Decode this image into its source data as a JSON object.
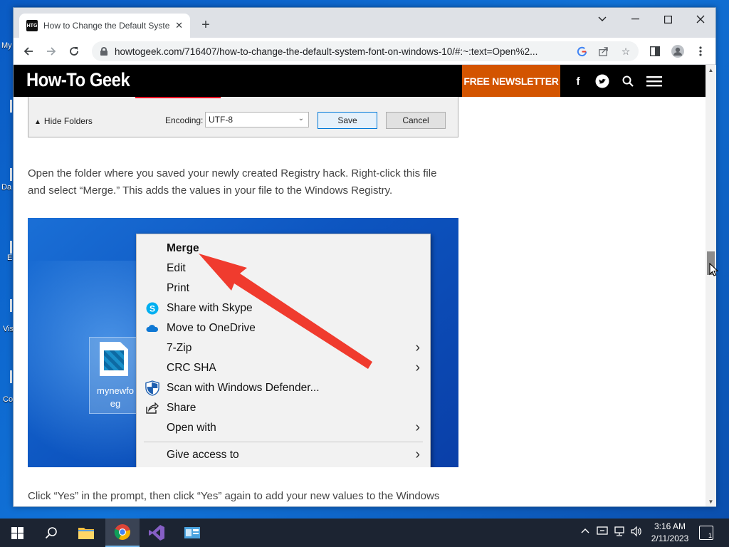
{
  "desktop": {
    "icon_labels": [
      "My",
      "Da",
      "E",
      "Vis",
      "Co"
    ]
  },
  "browser": {
    "tab_title": "How to Change the Default Syste",
    "favicon_text": "HTG",
    "url": "howtogeek.com/716407/how-to-change-the-default-system-font-on-windows-10/#:~:text=Open%2..."
  },
  "site": {
    "logo": "How-To Geek",
    "newsletter": "FREE NEWSLETTER"
  },
  "save_dialog": {
    "hide_folders": "Hide Folders",
    "encoding_label": "Encoding:",
    "encoding_value": "UTF-8",
    "save": "Save",
    "cancel": "Cancel"
  },
  "article": {
    "para1": "Open the folder where you saved your newly created Registry hack. Right-click this file and select “Merge.” This adds the values in your file to the Windows Registry.",
    "para2": "Click “Yes” in the prompt, then click “Yes” again to add your new values to the Windows Registry."
  },
  "context_screenshot": {
    "file_name_line1": "mynewfo",
    "file_name_line2": "eg",
    "items": [
      {
        "label": "Merge",
        "bold": true
      },
      {
        "label": "Edit"
      },
      {
        "label": "Print"
      },
      {
        "label": "Share with Skype",
        "icon": "skype-icon"
      },
      {
        "label": "Move to OneDrive",
        "icon": "onedrive-icon"
      },
      {
        "label": "7-Zip",
        "submenu": true
      },
      {
        "label": "CRC SHA",
        "submenu": true
      },
      {
        "label": "Scan with Windows Defender...",
        "icon": "defender-shield-icon"
      },
      {
        "label": "Share",
        "icon": "share-icon"
      },
      {
        "label": "Open with",
        "submenu": true
      },
      {
        "label": "Give access to",
        "submenu": true
      }
    ],
    "arrow_color": "#f03b2e"
  },
  "taskbar": {
    "time": "3:16 AM",
    "date": "2/11/2023",
    "notification_count": "1"
  },
  "colors": {
    "brand_orange": "#d35400",
    "header_black": "#000000"
  }
}
